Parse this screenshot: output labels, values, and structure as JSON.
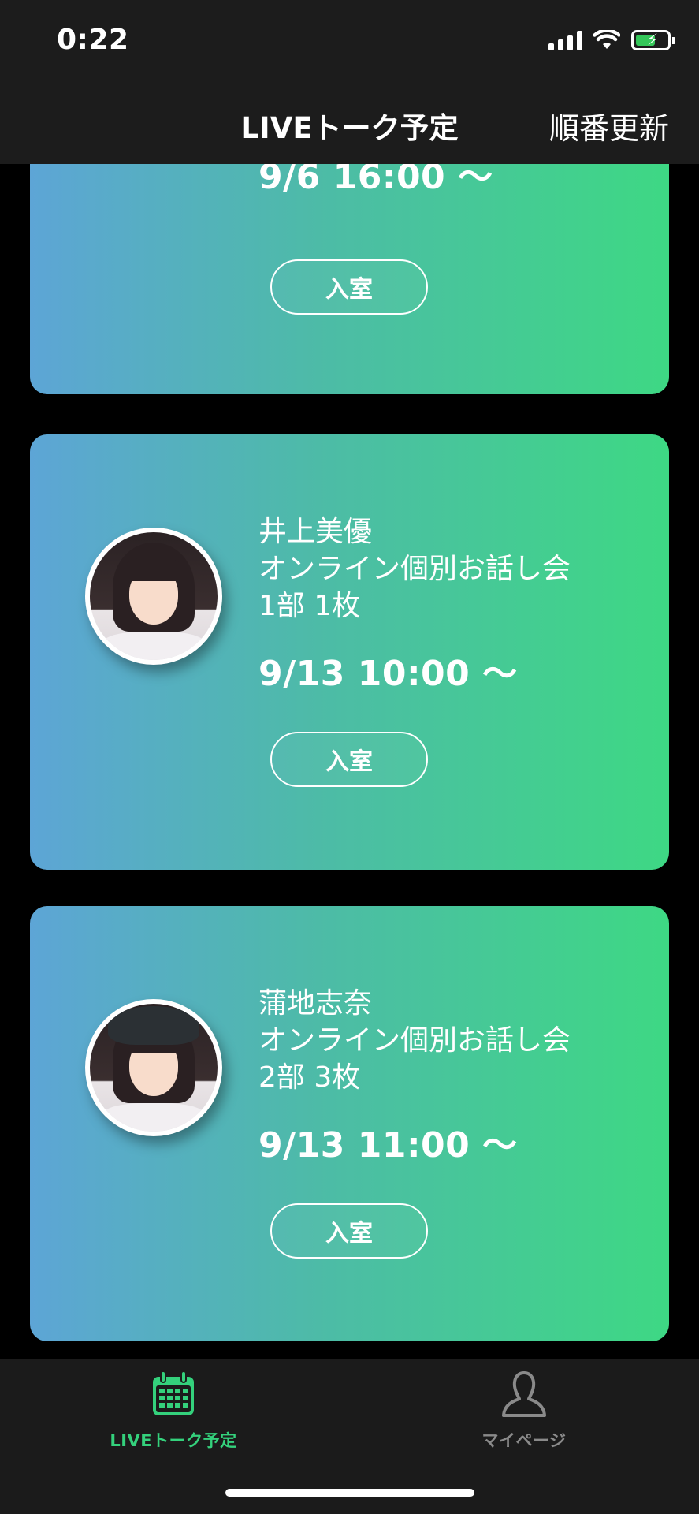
{
  "status": {
    "time": "0:22"
  },
  "header": {
    "title": "LIVEトーク予定",
    "action": "順番更新"
  },
  "events": [
    {
      "name_lines": [],
      "datetime": "9/6 16:00 〜",
      "enter_label": "入室"
    },
    {
      "name_lines": [
        "井上美優",
        "オンライン個別お話し会",
        "1部 1枚"
      ],
      "datetime": "9/13 10:00 〜",
      "enter_label": "入室"
    },
    {
      "name_lines": [
        "蒲地志奈",
        "オンライン個別お話し会",
        "2部 3枚"
      ],
      "datetime": "9/13 11:00 〜",
      "enter_label": "入室"
    }
  ],
  "tabs": [
    {
      "label": "LIVEトーク予定",
      "icon": "calendar-icon",
      "active": true,
      "color": "#34d17c"
    },
    {
      "label": "マイページ",
      "icon": "person-icon",
      "active": false,
      "color": "#8a8a8a"
    }
  ],
  "colors": {
    "gradient_start": "#5da5d6",
    "gradient_end": "#3ed884",
    "accent": "#34d17c"
  }
}
